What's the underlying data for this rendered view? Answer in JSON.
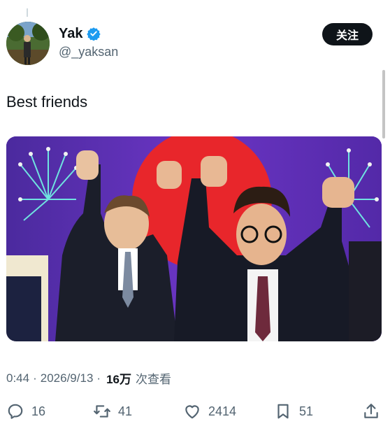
{
  "author": {
    "display_name": "Yak",
    "handle": "@_yaksan",
    "verified": true,
    "follow_label": "关注"
  },
  "tweet": {
    "text": "Best friends",
    "image_alt_icon": "photo-of-people-raising-joined-hands"
  },
  "meta": {
    "time": "0:44",
    "separator1": "·",
    "date": "2026/9/13",
    "separator2": "·",
    "views_count": "16万",
    "views_label": "次查看"
  },
  "actions": {
    "replies": "16",
    "retweets": "41",
    "likes": "2414",
    "bookmarks": "51"
  },
  "colors": {
    "text": "#0f1419",
    "secondary": "#536471",
    "verified": "#1d9bf0",
    "button_bg": "#0f1419"
  }
}
